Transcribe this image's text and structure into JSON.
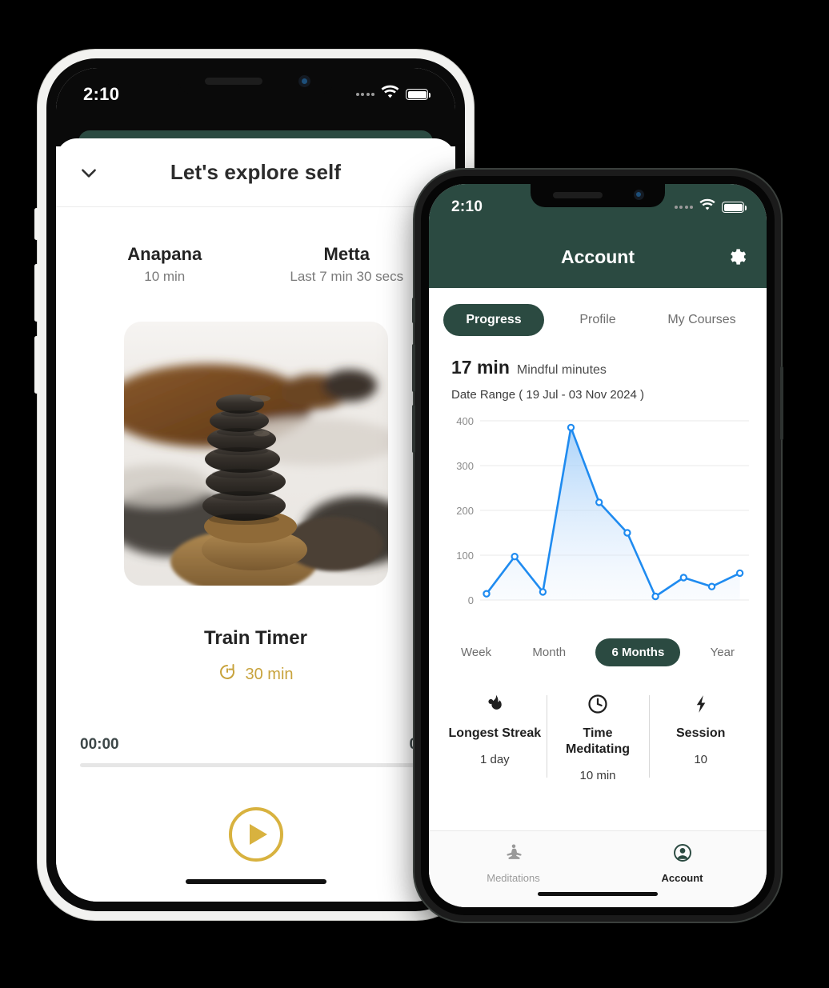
{
  "left_phone": {
    "status_bar": {
      "time": "2:10"
    },
    "sheet": {
      "title": "Let's explore self",
      "collapse_icon": "chevron-down-icon"
    },
    "modes": [
      {
        "name": "Anapana",
        "sub": "10 min"
      },
      {
        "name": "Metta",
        "sub": "Last 7 min 30 secs"
      }
    ],
    "hero_image": {
      "alt": "stacked-stones-cairn"
    },
    "timer": {
      "title": "Train Timer",
      "duration_icon": "timer-icon",
      "duration": "30 min",
      "elapsed": "00:00",
      "total": "00:",
      "play_icon": "play-icon"
    }
  },
  "right_phone": {
    "status_bar": {
      "time": "2:10"
    },
    "header": {
      "title": "Account",
      "settings_icon": "gear-icon"
    },
    "tabs": [
      {
        "label": "Progress",
        "active": true
      },
      {
        "label": "Profile",
        "active": false
      },
      {
        "label": "My Courses",
        "active": false
      }
    ],
    "summary": {
      "value": "17 min",
      "label": "Mindful minutes",
      "date_range": "Date Range ( 19 Jul - 03 Nov 2024 )"
    },
    "ranges": [
      {
        "label": "Week",
        "active": false
      },
      {
        "label": "Month",
        "active": false
      },
      {
        "label": "6 Months",
        "active": true
      },
      {
        "label": "Year",
        "active": false
      }
    ],
    "stats": [
      {
        "icon": "flame-icon",
        "title": "Longest Streak",
        "value": "1 day"
      },
      {
        "icon": "clock-icon",
        "title": "Time Meditating",
        "value": "10 min"
      },
      {
        "icon": "bolt-icon",
        "title": "Session",
        "value": "10"
      }
    ],
    "tabbar": [
      {
        "icon": "meditation-icon",
        "label": "Meditations",
        "active": false
      },
      {
        "icon": "account-icon",
        "label": "Account",
        "active": true
      }
    ]
  },
  "colors": {
    "brand_green": "#2b4a41",
    "accent_gold": "#d8b23f",
    "chart_line": "#1f8bf0",
    "chart_fill": "#bcdcfb"
  },
  "chart_data": {
    "type": "area",
    "title": "Mindful minutes",
    "subtitle": "Date Range ( 19 Jul - 03 Nov 2024 )",
    "xlabel": "",
    "ylabel": "",
    "ylim": [
      0,
      400
    ],
    "yticks": [
      0,
      100,
      200,
      300,
      400
    ],
    "grid": true,
    "legend": false,
    "x": [
      1,
      2,
      3,
      4,
      5,
      6,
      7,
      8,
      9,
      10
    ],
    "values": [
      14,
      97,
      18,
      385,
      218,
      150,
      8,
      50,
      30,
      60
    ],
    "series": [
      {
        "name": "Mindful minutes",
        "values": [
          14,
          97,
          18,
          385,
          218,
          150,
          8,
          50,
          30,
          60
        ]
      }
    ]
  }
}
